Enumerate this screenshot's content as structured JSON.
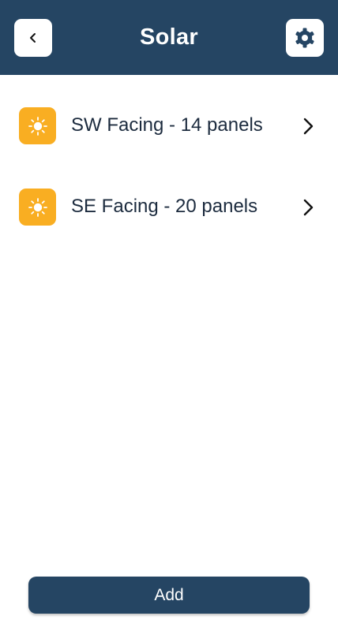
{
  "header": {
    "title": "Solar",
    "back_icon": "chevron-left-icon",
    "settings_icon": "gear-icon"
  },
  "arrays": [
    {
      "label": "SW Facing - 14 panels",
      "icon": "sun-icon"
    },
    {
      "label": "SE Facing - 20 panels",
      "icon": "sun-icon"
    }
  ],
  "footer": {
    "add_label": "Add"
  },
  "colors": {
    "header_bg": "#254563",
    "icon_bg": "#f9ae22",
    "text": "#1c2b3e",
    "button_bg": "#254563"
  }
}
